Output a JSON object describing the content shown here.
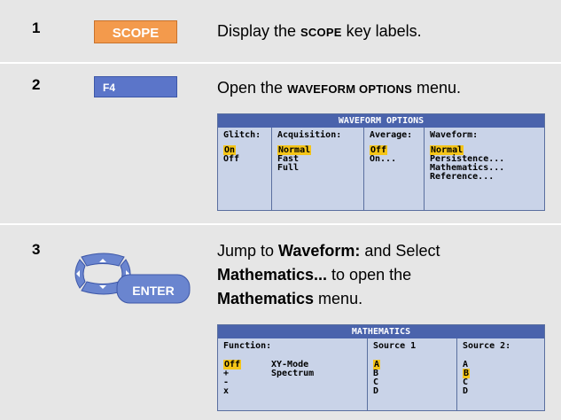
{
  "steps": [
    {
      "number": "1",
      "key_label": "SCOPE",
      "text_pre": "Display the ",
      "text_kw": "SCOPE",
      "text_post": " key labels."
    },
    {
      "number": "2",
      "key_label": "F4",
      "text_pre": "Open the ",
      "text_kw": "WAVEFORM OPTIONS",
      "text_post": " menu."
    },
    {
      "number": "3",
      "key_label": "ENTER",
      "line1_pre": "Jump to ",
      "line1_bold": "Waveform:",
      "line1_post": " and Select",
      "line2_bold": "Mathematics...",
      "line2_post": " to open the",
      "line3_bold": "Mathematics",
      "line3_post": " menu."
    }
  ],
  "waveform_options": {
    "title": "WAVEFORM OPTIONS",
    "columns": [
      {
        "header": "Glitch:",
        "items": [
          "On",
          "Off"
        ],
        "selected": 0
      },
      {
        "header": "Acquisition:",
        "items": [
          "Normal",
          "Fast",
          "Full"
        ],
        "selected": 0
      },
      {
        "header": "Average:",
        "items": [
          "Off",
          "On..."
        ],
        "selected": 0
      },
      {
        "header": "Waveform:",
        "items": [
          "Normal",
          "Persistence...",
          "Mathematics...",
          "Reference..."
        ],
        "selected": 0
      }
    ]
  },
  "mathematics": {
    "title": "MATHEMATICS",
    "function_header": "Function:",
    "function_items": [
      "Off",
      "+",
      "-",
      "x"
    ],
    "function_selected": 0,
    "mode_items": [
      "XY-Mode",
      "Spectrum"
    ],
    "source1_header": "Source 1",
    "source1_items": [
      "A",
      "B",
      "C",
      "D"
    ],
    "source1_selected": 0,
    "source2_header": "Source 2:",
    "source2_items": [
      "A",
      "B",
      "C",
      "D"
    ],
    "source2_selected": 1
  },
  "colors": {
    "scope_key": "#f39a4c",
    "f4_key": "#5b75c9",
    "nav_key": "#6a85cf",
    "menu_title": "#4a63ac",
    "highlight": "#f5c518"
  }
}
